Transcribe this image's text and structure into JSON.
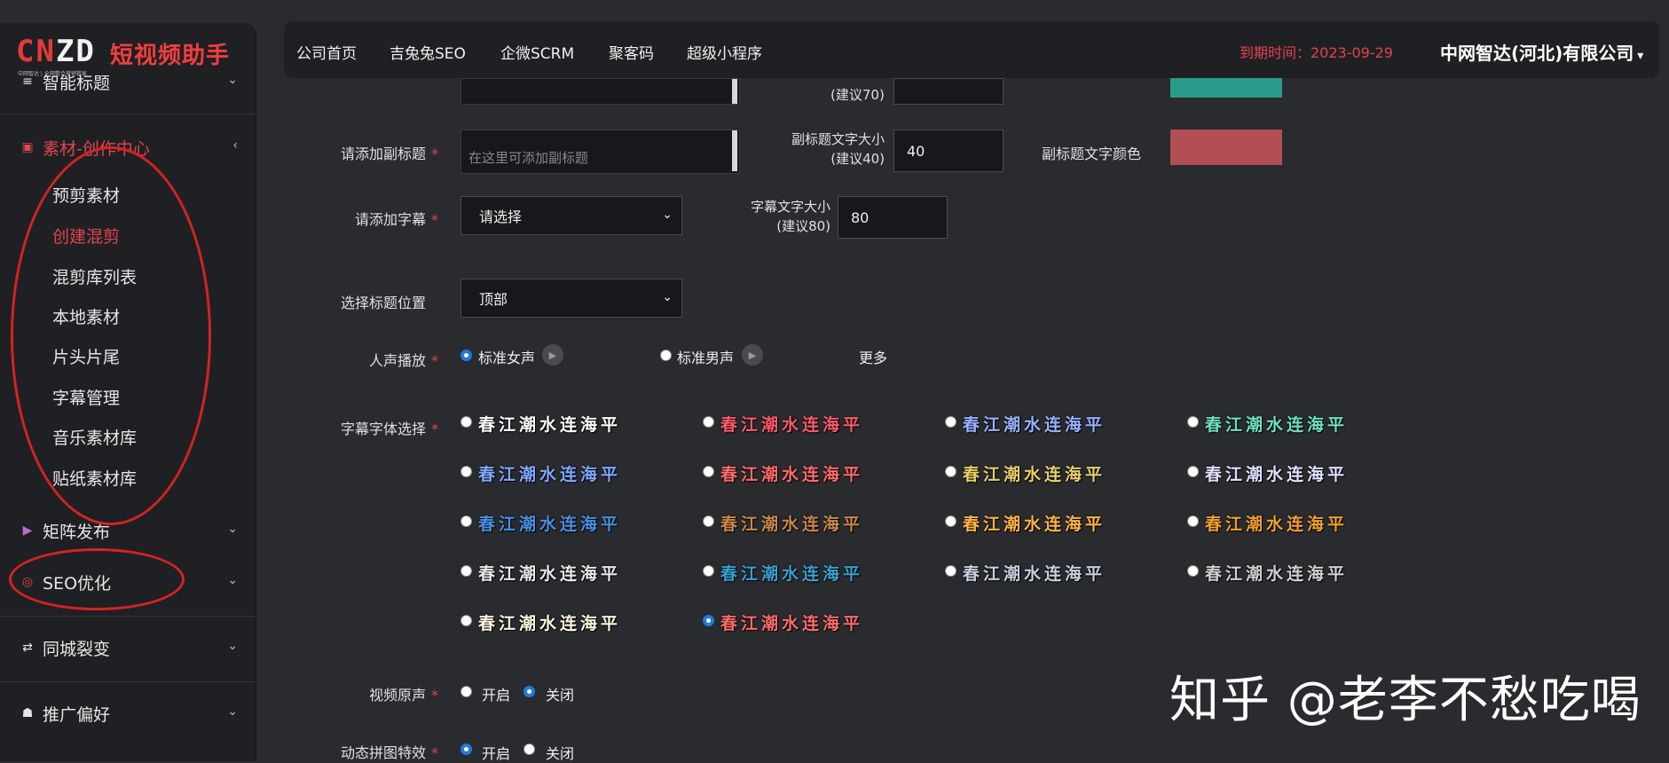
{
  "logo": {
    "brand_left": "CN",
    "brand_right": "ZD",
    "tagline": "中网智达 | 全网整合营销管家",
    "title": "短视频助手"
  },
  "sidebar": {
    "top_item": "智能标题",
    "section_open": "素材-创作中心",
    "sub_items": [
      "预剪素材",
      "创建混剪",
      "混剪库列表",
      "本地素材",
      "片头片尾",
      "字幕管理",
      "音乐素材库",
      "贴纸素材库"
    ],
    "active_sub_index": 1,
    "matrix": "矩阵发布",
    "seo": "SEO优化",
    "city": "同城裂变",
    "promo": "推广偏好"
  },
  "topnav": {
    "items": [
      "公司首页",
      "吉兔兔SEO",
      "企微SCRM",
      "聚客码",
      "超级小程序"
    ],
    "expire_label": "到期时间：2023-09-29",
    "company": "中网智达(河北)有限公司",
    "company_caret": "▾"
  },
  "form": {
    "title_suggest": "(建议70)",
    "subtitle_label": "请添加副标题",
    "subtitle_placeholder": "在这里可添加副标题",
    "subtitle_size_label": "副标题文字大小",
    "subtitle_size_suggest": "(建议40)",
    "subtitle_size_value": "40",
    "subtitle_color_label": "副标题文字颜色",
    "subtitle_color": "#b24e52",
    "title_color": "#2a9a8a",
    "caption_label": "请添加字幕",
    "caption_select": "请选择",
    "caption_size_label": "字幕文字大小",
    "caption_size_suggest": "(建议80)",
    "caption_size_value": "80",
    "title_pos_label": "选择标题位置",
    "title_pos_value": "顶部",
    "voice_label": "人声播放",
    "voice_female": "标准女声",
    "voice_male": "标准男声",
    "voice_more": "更多",
    "font_label": "字幕字体选择",
    "font_sample": "春江潮水连海平",
    "font_colors": [
      [
        "#ffffff",
        "#ff5a6a",
        "#9ab0ff",
        "#6de0c0"
      ],
      [
        "#7fa8ff",
        "#ff6b6b",
        "#e8d06a",
        "#e0e0ff"
      ],
      [
        "#4a90e2",
        "#c8884a",
        "#ffb347",
        "#f0a030"
      ],
      [
        "#e8e8e8",
        "#3aa0d0",
        "#c8d0e0",
        "#d0d0d0"
      ],
      [
        "#fff7e0",
        "#ff6b6b"
      ]
    ],
    "font_selected": [
      4,
      1
    ],
    "orig_audio_label": "视频原声",
    "on": "开启",
    "off": "关闭",
    "puzzle_label": "动态拼图特效"
  },
  "watermark": "知乎 @老李不愁吃喝",
  "colors": {
    "accent_red": "#e0454f",
    "radio_blue": "#1f7ae0",
    "sidebar_bg": "#1f2023",
    "content_bg": "#2a2b2f"
  },
  "icons": [
    "menu-icon",
    "video-icon",
    "matrix-icon",
    "seo-icon",
    "share-icon",
    "robot-icon",
    "chevron-down-icon",
    "chevron-left-icon",
    "play-icon"
  ]
}
